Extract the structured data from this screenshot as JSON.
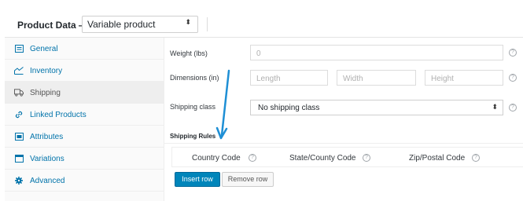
{
  "header": {
    "title": "Product Data —",
    "product_type": "Variable product"
  },
  "sidebar": {
    "items": [
      {
        "label": "General",
        "icon": "general-icon"
      },
      {
        "label": "Inventory",
        "icon": "inventory-icon"
      },
      {
        "label": "Shipping",
        "icon": "shipping-icon",
        "active": true
      },
      {
        "label": "Linked Products",
        "icon": "link-icon"
      },
      {
        "label": "Attributes",
        "icon": "attributes-icon"
      },
      {
        "label": "Variations",
        "icon": "variations-icon"
      },
      {
        "label": "Advanced",
        "icon": "gear-icon"
      }
    ]
  },
  "shipping": {
    "weight_label": "Weight (lbs)",
    "weight_placeholder": "0",
    "dimensions_label": "Dimensions (in)",
    "length_placeholder": "Length",
    "width_placeholder": "Width",
    "height_placeholder": "Height",
    "class_label": "Shipping class",
    "class_value": "No shipping class"
  },
  "rules": {
    "title": "Shipping Rules",
    "columns": [
      "Country Code",
      "State/County Code",
      "Zip/Postal Code"
    ],
    "insert_label": "Insert row",
    "remove_label": "Remove row"
  },
  "colors": {
    "accent": "#0085ba",
    "link": "#0073aa",
    "arrow": "#1e8fd5"
  }
}
